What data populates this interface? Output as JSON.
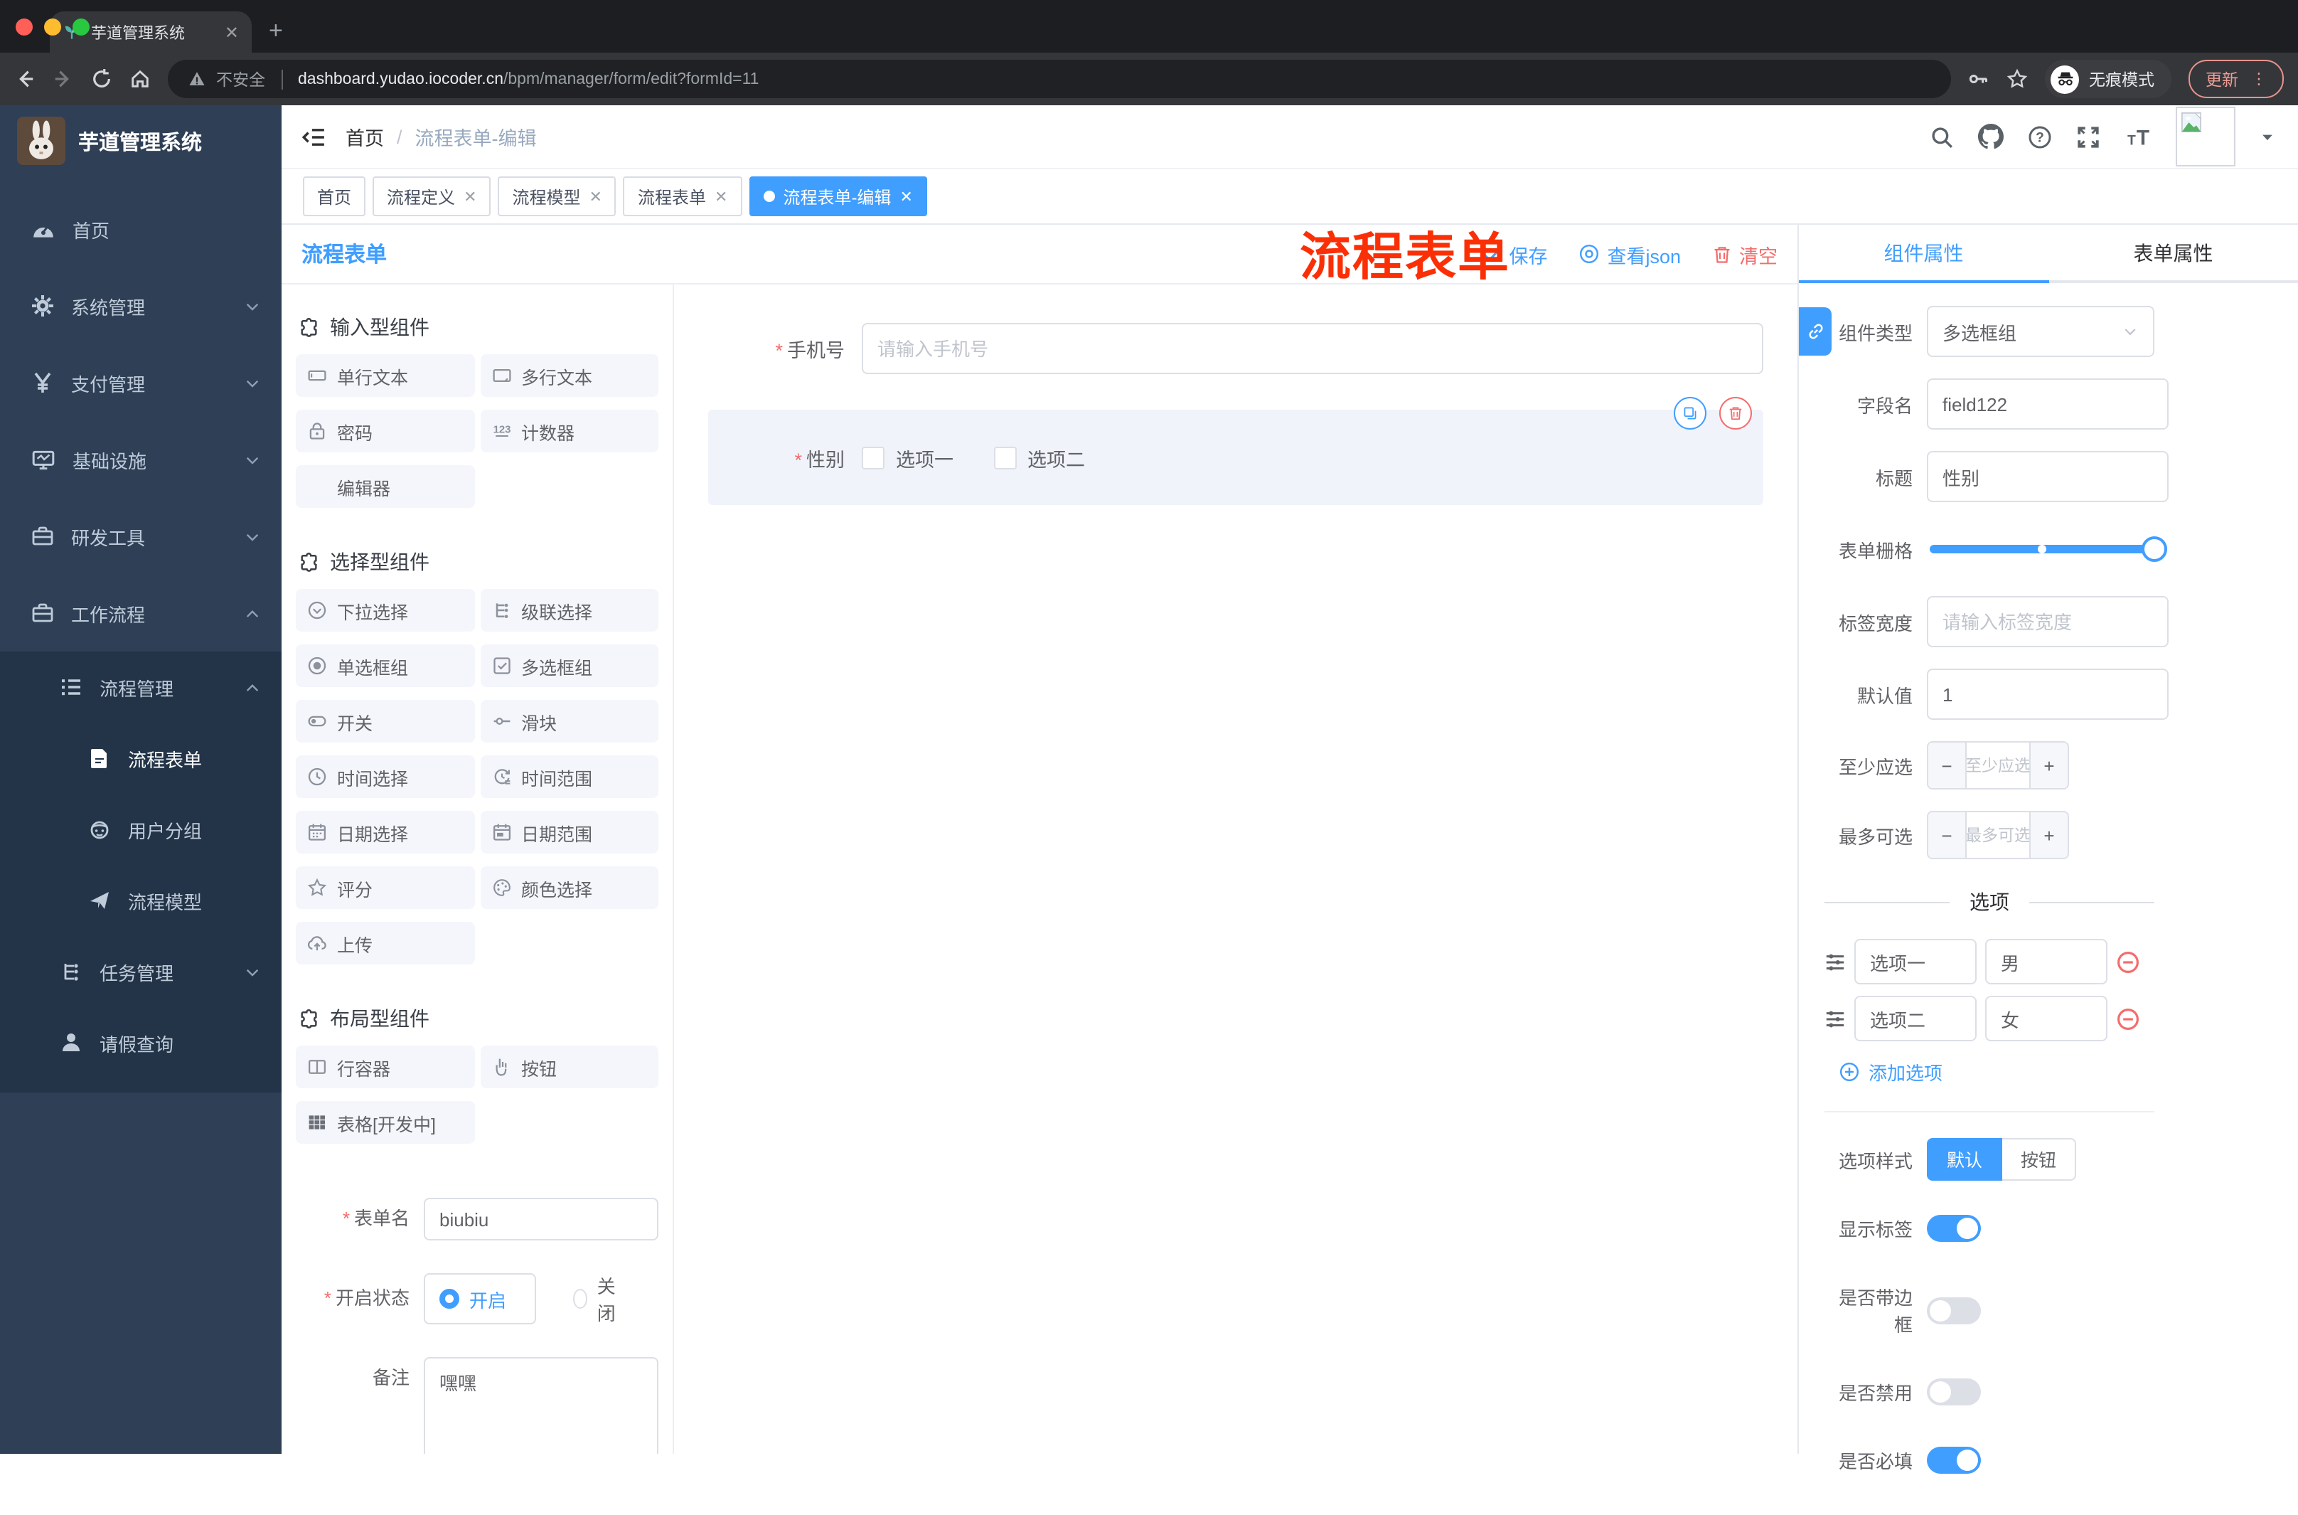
{
  "browser": {
    "tab_title": "芋道管理系统",
    "security_label": "不安全",
    "url_host": "dashboard.yudao.iocoder.cn",
    "url_path": "/bpm/manager/form/edit?formId=11",
    "incognito_label": "无痕模式",
    "update_label": "更新"
  },
  "annotation": {
    "text": "流程表单"
  },
  "sidebar": {
    "title": "芋道管理系统",
    "items": [
      {
        "label": "首页"
      },
      {
        "label": "系统管理"
      },
      {
        "label": "支付管理"
      },
      {
        "label": "基础设施"
      },
      {
        "label": "研发工具"
      },
      {
        "label": "工作流程"
      },
      {
        "label": "流程管理"
      },
      {
        "label": "流程表单"
      },
      {
        "label": "用户分组"
      },
      {
        "label": "流程模型"
      },
      {
        "label": "任务管理"
      },
      {
        "label": "请假查询"
      }
    ]
  },
  "header": {
    "breadcrumb": {
      "home": "首页",
      "sep": "/",
      "current": "流程表单-编辑"
    }
  },
  "tags": {
    "items": [
      "首页",
      "流程定义",
      "流程模型",
      "流程表单",
      "流程表单-编辑"
    ]
  },
  "designer": {
    "title": "流程表单",
    "save": "保存",
    "view_json": "查看json",
    "clear": "清空",
    "sections": {
      "input": "输入型组件",
      "select": "选择型组件",
      "layout": "布局型组件"
    },
    "components": {
      "input": [
        "单行文本",
        "多行文本",
        "密码",
        "计数器",
        "编辑器"
      ],
      "select": [
        "下拉选择",
        "级联选择",
        "单选框组",
        "多选框组",
        "开关",
        "滑块",
        "时间选择",
        "时间范围",
        "日期选择",
        "日期范围",
        "评分",
        "颜色选择",
        "上传"
      ],
      "layout": [
        "行容器",
        "按钮",
        "表格[开发中]"
      ]
    },
    "form": {
      "name_label": "表单名",
      "name_value": "biubiu",
      "status_label": "开启状态",
      "status_on": "开启",
      "status_off": "关闭",
      "remark_label": "备注",
      "remark_value": "嘿嘿"
    }
  },
  "canvas": {
    "phone": {
      "label": "手机号",
      "placeholder": "请输入手机号"
    },
    "gender": {
      "label": "性别",
      "option1": "选项一",
      "option2": "选项二"
    }
  },
  "props": {
    "tab_component": "组件属性",
    "tab_form": "表单属性",
    "type_label": "组件类型",
    "type_value": "多选框组",
    "field_label": "字段名",
    "field_value": "field122",
    "title_label": "标题",
    "title_value": "性别",
    "grid_label": "表单栅格",
    "label_width_label": "标签宽度",
    "label_width_placeholder": "请输入标签宽度",
    "default_label": "默认值",
    "default_value": "1",
    "min_label": "至少应选",
    "min_placeholder": "至少应选",
    "max_label": "最多可选",
    "max_placeholder": "最多可选",
    "options_divider": "选项",
    "options": [
      {
        "label": "选项一",
        "value": "男"
      },
      {
        "label": "选项二",
        "value": "女"
      }
    ],
    "add_option": "添加选项",
    "style_label": "选项样式",
    "style_default": "默认",
    "style_button": "按钮",
    "show_label_label": "显示标签",
    "border_label": "是否带边框",
    "disabled_label": "是否禁用",
    "required_label": "是否必填"
  },
  "colors": {
    "accent": "#409eff",
    "danger": "#f56c6c",
    "sidebar": "#2e3f56",
    "annotation": "#fb2f06"
  }
}
